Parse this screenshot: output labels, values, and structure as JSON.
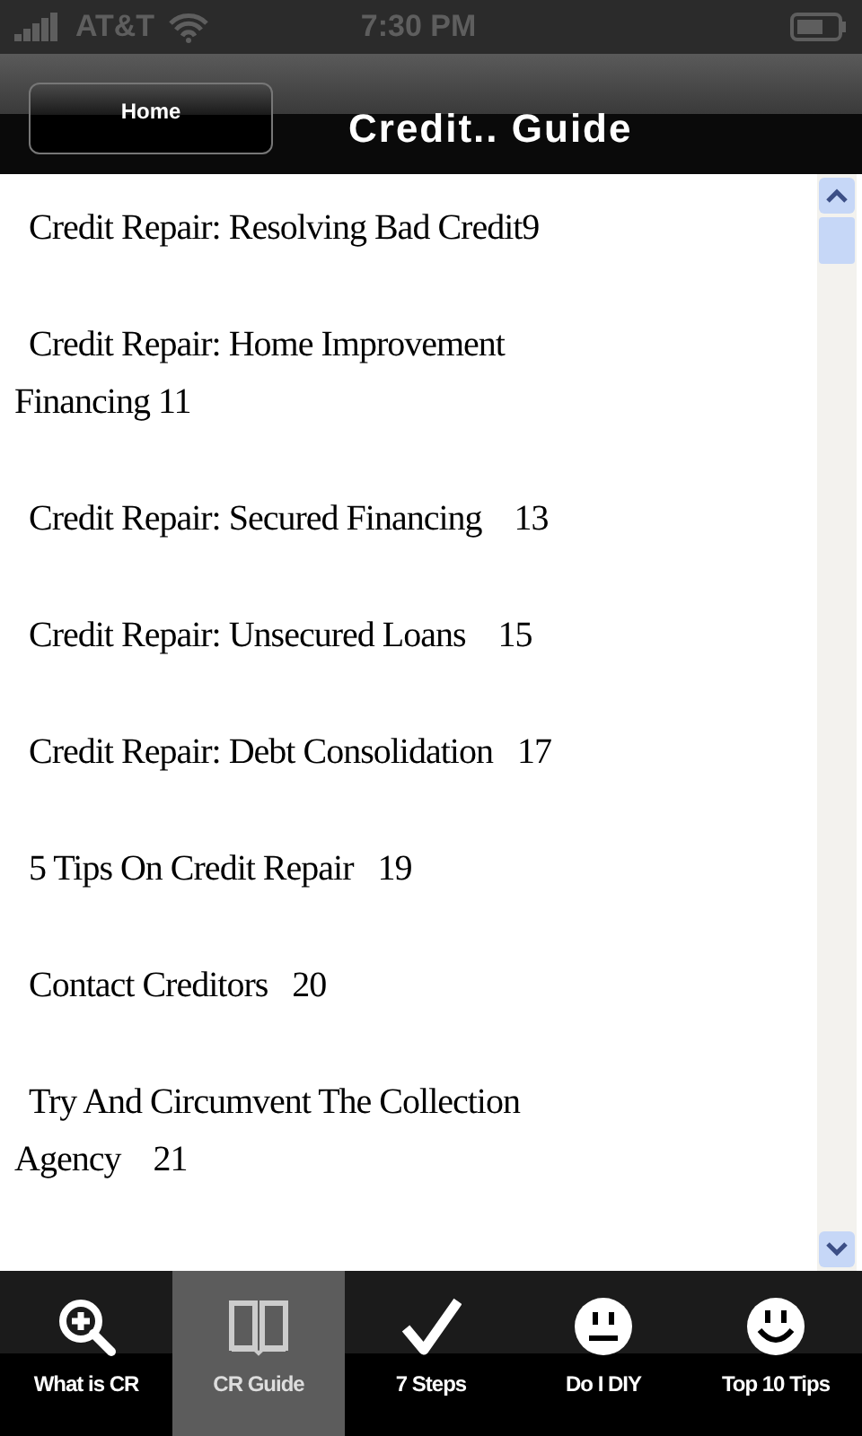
{
  "status_bar": {
    "carrier": "AT&T",
    "time": "7:30 PM"
  },
  "nav_bar": {
    "back_button": "Home",
    "title": "Credit.. Guide"
  },
  "entries": [
    {
      "lines": [
        "Credit Repair: Resolving Bad Credit9"
      ]
    },
    {
      "lines": [
        "Credit Repair: Home Improvement",
        "Financing 11"
      ]
    },
    {
      "lines": [
        "Credit Repair: Secured Financing    13"
      ]
    },
    {
      "lines": [
        "Credit Repair: Unsecured Loans    15"
      ]
    },
    {
      "lines": [
        "Credit Repair: Debt Consolidation   17"
      ]
    },
    {
      "lines": [
        "5 Tips On Credit Repair   19"
      ]
    },
    {
      "lines": [
        "Contact Creditors   20"
      ]
    },
    {
      "lines": [
        "Try And Circumvent The Collection",
        "Agency    21"
      ]
    }
  ],
  "tab_bar": [
    {
      "label": "What is CR",
      "selected": false
    },
    {
      "label": "CR Guide",
      "selected": true
    },
    {
      "label": "7 Steps",
      "selected": false
    },
    {
      "label": "Do I DIY",
      "selected": false
    },
    {
      "label": "Top 10 Tips",
      "selected": false
    }
  ]
}
